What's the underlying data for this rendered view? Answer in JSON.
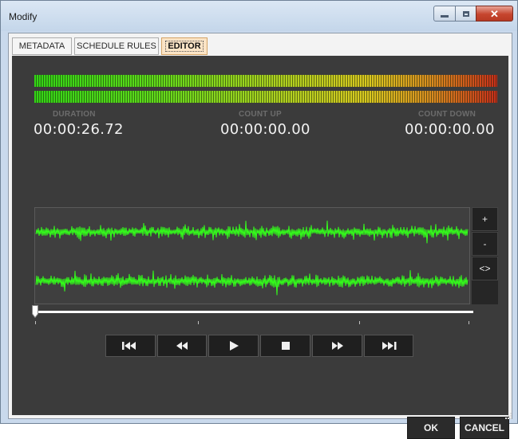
{
  "window": {
    "title": "Modify"
  },
  "tabs": [
    {
      "label": "METADATA"
    },
    {
      "label": "SCHEDULE RULES"
    },
    {
      "label": "EDITOR",
      "active": true
    }
  ],
  "timers": {
    "duration": {
      "label": "DURATION",
      "value": "00:00:26.72"
    },
    "count_up": {
      "label": "COUNT UP",
      "value": "00:00:00.00"
    },
    "count_down": {
      "label": "COUNT DOWN",
      "value": "00:00:00.00"
    }
  },
  "zoom": {
    "in_label": "+",
    "out_label": "-",
    "fit_label": "<>"
  },
  "playback_position": 0,
  "transport": [
    {
      "name": "skip-to-start",
      "icon": "skip-back-icon"
    },
    {
      "name": "rewind",
      "icon": "rewind-icon"
    },
    {
      "name": "play",
      "icon": "play-icon"
    },
    {
      "name": "stop",
      "icon": "stop-icon"
    },
    {
      "name": "fast-forward",
      "icon": "fast-forward-icon"
    },
    {
      "name": "skip-to-end",
      "icon": "skip-forward-icon"
    }
  ],
  "footer": {
    "ok_label": "OK",
    "cancel_label": "CANCEL"
  },
  "colors": {
    "waveform": "#33ff1a",
    "panel_bg": "#3b3b3b",
    "active_tab": "#fbe4c6"
  }
}
